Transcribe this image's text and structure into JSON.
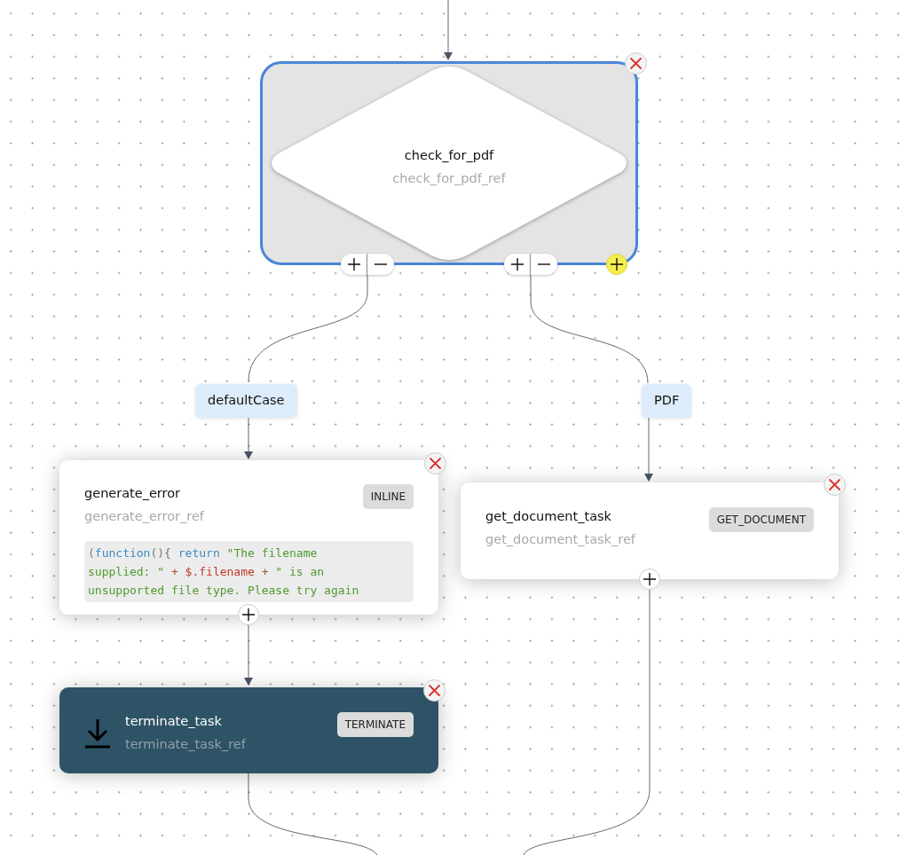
{
  "decision": {
    "name": "check_for_pdf",
    "ref": "check_for_pdf_ref",
    "selected": true
  },
  "branches": [
    {
      "label": "defaultCase"
    },
    {
      "label": "PDF"
    }
  ],
  "tasks": [
    {
      "kind": "inline",
      "name": "generate_error",
      "ref": "generate_error_ref",
      "type": "INLINE",
      "code": [
        [
          {
            "kind": "punct",
            "text": "("
          },
          {
            "kind": "keyword",
            "text": "function"
          },
          {
            "kind": "punct",
            "text": "(){ "
          },
          {
            "kind": "keyword",
            "text": "return"
          },
          {
            "kind": "string",
            "text": " \"The filename"
          }
        ],
        [
          {
            "kind": "string",
            "text": "supplied: \""
          },
          {
            "kind": "operator",
            "text": " + "
          },
          {
            "kind": "variable",
            "text": "$.filename"
          },
          {
            "kind": "operator",
            "text": " + "
          },
          {
            "kind": "string",
            "text": "\" is an"
          }
        ],
        [
          {
            "kind": "string",
            "text": "unsupported file type. Please try again"
          }
        ]
      ]
    },
    {
      "kind": "simple",
      "name": "get_document_task",
      "ref": "get_document_task_ref",
      "type": "GET_DOCUMENT"
    },
    {
      "kind": "terminate",
      "name": "terminate_task",
      "ref": "terminate_task_ref",
      "type": "TERMINATE"
    }
  ]
}
